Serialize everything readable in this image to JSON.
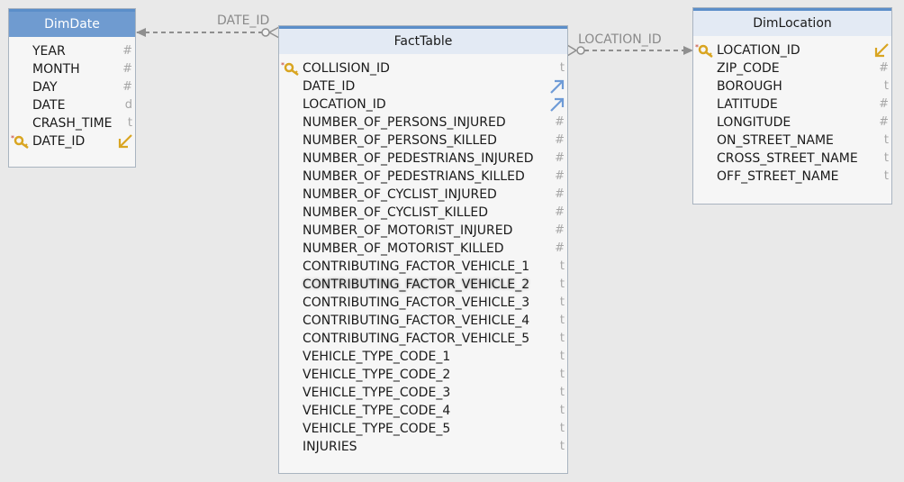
{
  "tables": {
    "dimdate": {
      "title": "DimDate",
      "columns": [
        {
          "name": "YEAR",
          "type": "#"
        },
        {
          "name": "MONTH",
          "type": "#"
        },
        {
          "name": "DAY",
          "type": "#"
        },
        {
          "name": "DATE",
          "type": "d"
        },
        {
          "name": "CRASH_TIME",
          "type": "t"
        },
        {
          "name": "DATE_ID",
          "type": ""
        }
      ]
    },
    "fact": {
      "title": "FactTable",
      "columns": [
        {
          "name": "COLLISION_ID",
          "type": "t"
        },
        {
          "name": "DATE_ID",
          "type": ""
        },
        {
          "name": "LOCATION_ID",
          "type": ""
        },
        {
          "name": "NUMBER_OF_PERSONS_INJURED",
          "type": "#"
        },
        {
          "name": "NUMBER_OF_PERSONS_KILLED",
          "type": "#"
        },
        {
          "name": "NUMBER_OF_PEDESTRIANS_INJURED",
          "type": "#"
        },
        {
          "name": "NUMBER_OF_PEDESTRIANS_KILLED",
          "type": "#"
        },
        {
          "name": "NUMBER_OF_CYCLIST_INJURED",
          "type": "#"
        },
        {
          "name": "NUMBER_OF_CYCLIST_KILLED",
          "type": "#"
        },
        {
          "name": "NUMBER_OF_MOTORIST_INJURED",
          "type": "#"
        },
        {
          "name": "NUMBER_OF_MOTORIST_KILLED",
          "type": "#"
        },
        {
          "name": "CONTRIBUTING_FACTOR_VEHICLE_1",
          "type": "t"
        },
        {
          "name": "CONTRIBUTING_FACTOR_VEHICLE_2",
          "type": "t"
        },
        {
          "name": "CONTRIBUTING_FACTOR_VEHICLE_3",
          "type": "t"
        },
        {
          "name": "CONTRIBUTING_FACTOR_VEHICLE_4",
          "type": "t"
        },
        {
          "name": "CONTRIBUTING_FACTOR_VEHICLE_5",
          "type": "t"
        },
        {
          "name": "VEHICLE_TYPE_CODE_1",
          "type": "t"
        },
        {
          "name": "VEHICLE_TYPE_CODE_2",
          "type": "t"
        },
        {
          "name": "VEHICLE_TYPE_CODE_3",
          "type": "t"
        },
        {
          "name": "VEHICLE_TYPE_CODE_4",
          "type": "t"
        },
        {
          "name": "VEHICLE_TYPE_CODE_5",
          "type": "t"
        },
        {
          "name": "INJURIES",
          "type": "t"
        }
      ]
    },
    "dimlocation": {
      "title": "DimLocation",
      "columns": [
        {
          "name": "LOCATION_ID",
          "type": ""
        },
        {
          "name": "ZIP_CODE",
          "type": "#"
        },
        {
          "name": "BOROUGH",
          "type": "t"
        },
        {
          "name": "LATITUDE",
          "type": "#"
        },
        {
          "name": "LONGITUDE",
          "type": "#"
        },
        {
          "name": "ON_STREET_NAME",
          "type": "t"
        },
        {
          "name": "CROSS_STREET_NAME",
          "type": "t"
        },
        {
          "name": "OFF_STREET_NAME",
          "type": "t"
        }
      ]
    }
  },
  "relationships": {
    "date": {
      "label": "DATE_ID"
    },
    "location": {
      "label": "LOCATION_ID"
    }
  },
  "colors": {
    "selected_header": "#6f9bd0",
    "header": "#e3eaf4",
    "link_line": "#8f8f8f",
    "key_gold": "#d9a521",
    "fk_arrow": "#6e9bd6"
  },
  "icons": {
    "primary_key": "key-icon",
    "fk_out": "fk-arrow-icon",
    "pk_ref": "pk-ref-arrow-icon"
  }
}
